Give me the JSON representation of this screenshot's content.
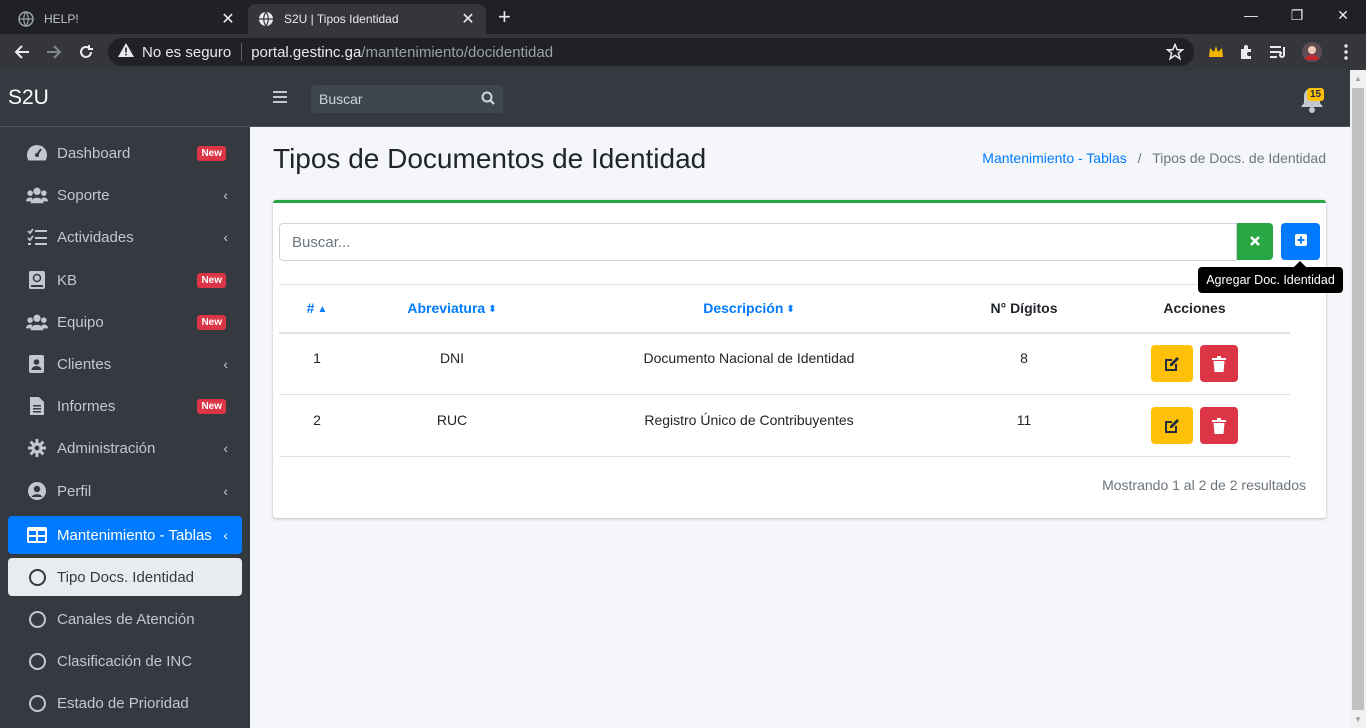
{
  "browser": {
    "tabs": [
      {
        "title": "HELP!",
        "close": "✕"
      },
      {
        "title": "S2U | Tipos Identidad",
        "close": "✕"
      }
    ],
    "new_tab": "+",
    "security_label": "No es seguro",
    "url_host": "portal.gestinc.ga",
    "url_path": "/mantenimiento/docidentidad",
    "window_controls": {
      "minimize": "—",
      "restore": "❐",
      "close": "✕"
    }
  },
  "sidebar": {
    "brand": "S2U",
    "items": [
      {
        "label": "Dashboard",
        "icon": "tachometer-icon",
        "badge": "New"
      },
      {
        "label": "Soporte",
        "icon": "users-icon",
        "chevron": "‹"
      },
      {
        "label": "Actividades",
        "icon": "tasks-icon",
        "chevron": "‹"
      },
      {
        "label": "KB",
        "icon": "book-icon",
        "badge": "New"
      },
      {
        "label": "Equipo",
        "icon": "users-icon",
        "badge": "New"
      },
      {
        "label": "Clientes",
        "icon": "address-book-icon",
        "chevron": "‹"
      },
      {
        "label": "Informes",
        "icon": "file-icon",
        "badge": "New"
      },
      {
        "label": "Administración",
        "icon": "gear-icon",
        "chevron": "‹"
      },
      {
        "label": "Perfil",
        "icon": "user-circle-icon",
        "chevron": "‹"
      },
      {
        "label": "Mantenimiento - Tablas",
        "icon": "table-icon",
        "chevron": "‹"
      }
    ],
    "subitems": [
      {
        "label": "Tipo Docs. Identidad"
      },
      {
        "label": "Canales de Atención"
      },
      {
        "label": "Clasificación de INC"
      },
      {
        "label": "Estado de Prioridad"
      }
    ]
  },
  "topnav": {
    "search_placeholder": "Buscar",
    "notifications_count": "15"
  },
  "page": {
    "title": "Tipos de Documentos de Identidad",
    "breadcrumb": {
      "parent": "Mantenimiento - Tablas",
      "separator": "/",
      "current": "Tipos de Docs. de Identidad"
    }
  },
  "card": {
    "search_placeholder": "Buscar...",
    "add_tooltip": "Agregar Doc. Identidad",
    "columns": {
      "num": "#",
      "abbr": "Abreviatura",
      "desc": "Descripción",
      "digits": "N° Dígitos",
      "actions": "Acciones"
    },
    "rows": [
      {
        "num": "1",
        "abbr": "DNI",
        "desc": "Documento Nacional de Identidad",
        "digits": "8"
      },
      {
        "num": "2",
        "abbr": "RUC",
        "desc": "Registro Único de Contribuyentes",
        "digits": "11"
      }
    ],
    "footer": "Mostrando 1 al 2 de 2 resultados"
  },
  "colors": {
    "sidebar_bg": "#343a40",
    "accent_blue": "#007bff",
    "success_green": "#28a745",
    "warning_yellow": "#ffc107",
    "danger_red": "#dc3545"
  }
}
